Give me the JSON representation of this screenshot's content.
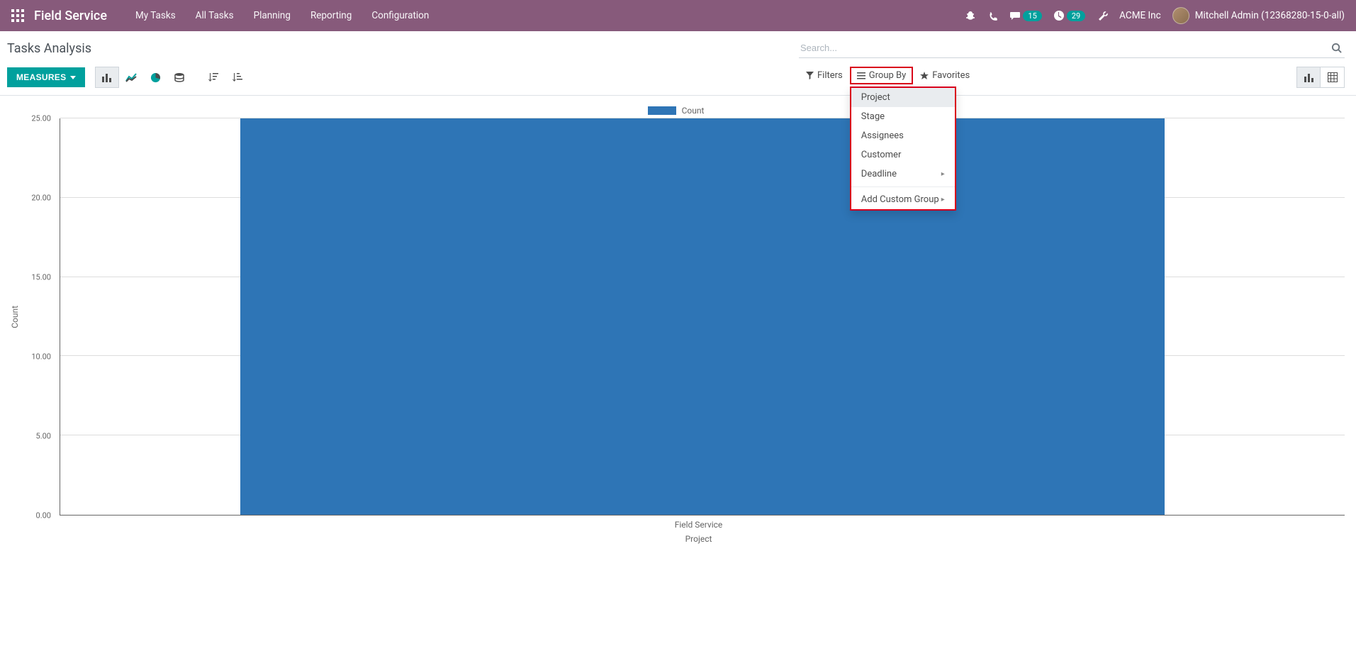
{
  "navbar": {
    "app_title": "Field Service",
    "menu": [
      "My Tasks",
      "All Tasks",
      "Planning",
      "Reporting",
      "Configuration"
    ],
    "conversations_badge": "15",
    "activities_badge": "29",
    "company": "ACME Inc",
    "user": "Mitchell Admin (12368280-15-0-all)"
  },
  "breadcrumb": "Tasks Analysis",
  "search": {
    "placeholder": "Search..."
  },
  "toolbar": {
    "measures_label": "MEASURES"
  },
  "search_options": {
    "filters": "Filters",
    "group_by": "Group By",
    "favorites": "Favorites"
  },
  "group_by_menu": {
    "items": [
      "Project",
      "Stage",
      "Assignees",
      "Customer",
      "Deadline"
    ],
    "add_custom": "Add Custom Group"
  },
  "legend": {
    "label": "Count"
  },
  "xaxis": {
    "category": "Field Service",
    "title": "Project"
  },
  "yaxis": {
    "label": "Count"
  },
  "chart_data": {
    "type": "bar",
    "categories": [
      "Field Service"
    ],
    "values": [
      25
    ],
    "title": "",
    "xlabel": "Project",
    "ylabel": "Count",
    "ylim": [
      0,
      25
    ],
    "yticks": [
      0.0,
      5.0,
      10.0,
      15.0,
      20.0,
      25.0
    ]
  }
}
